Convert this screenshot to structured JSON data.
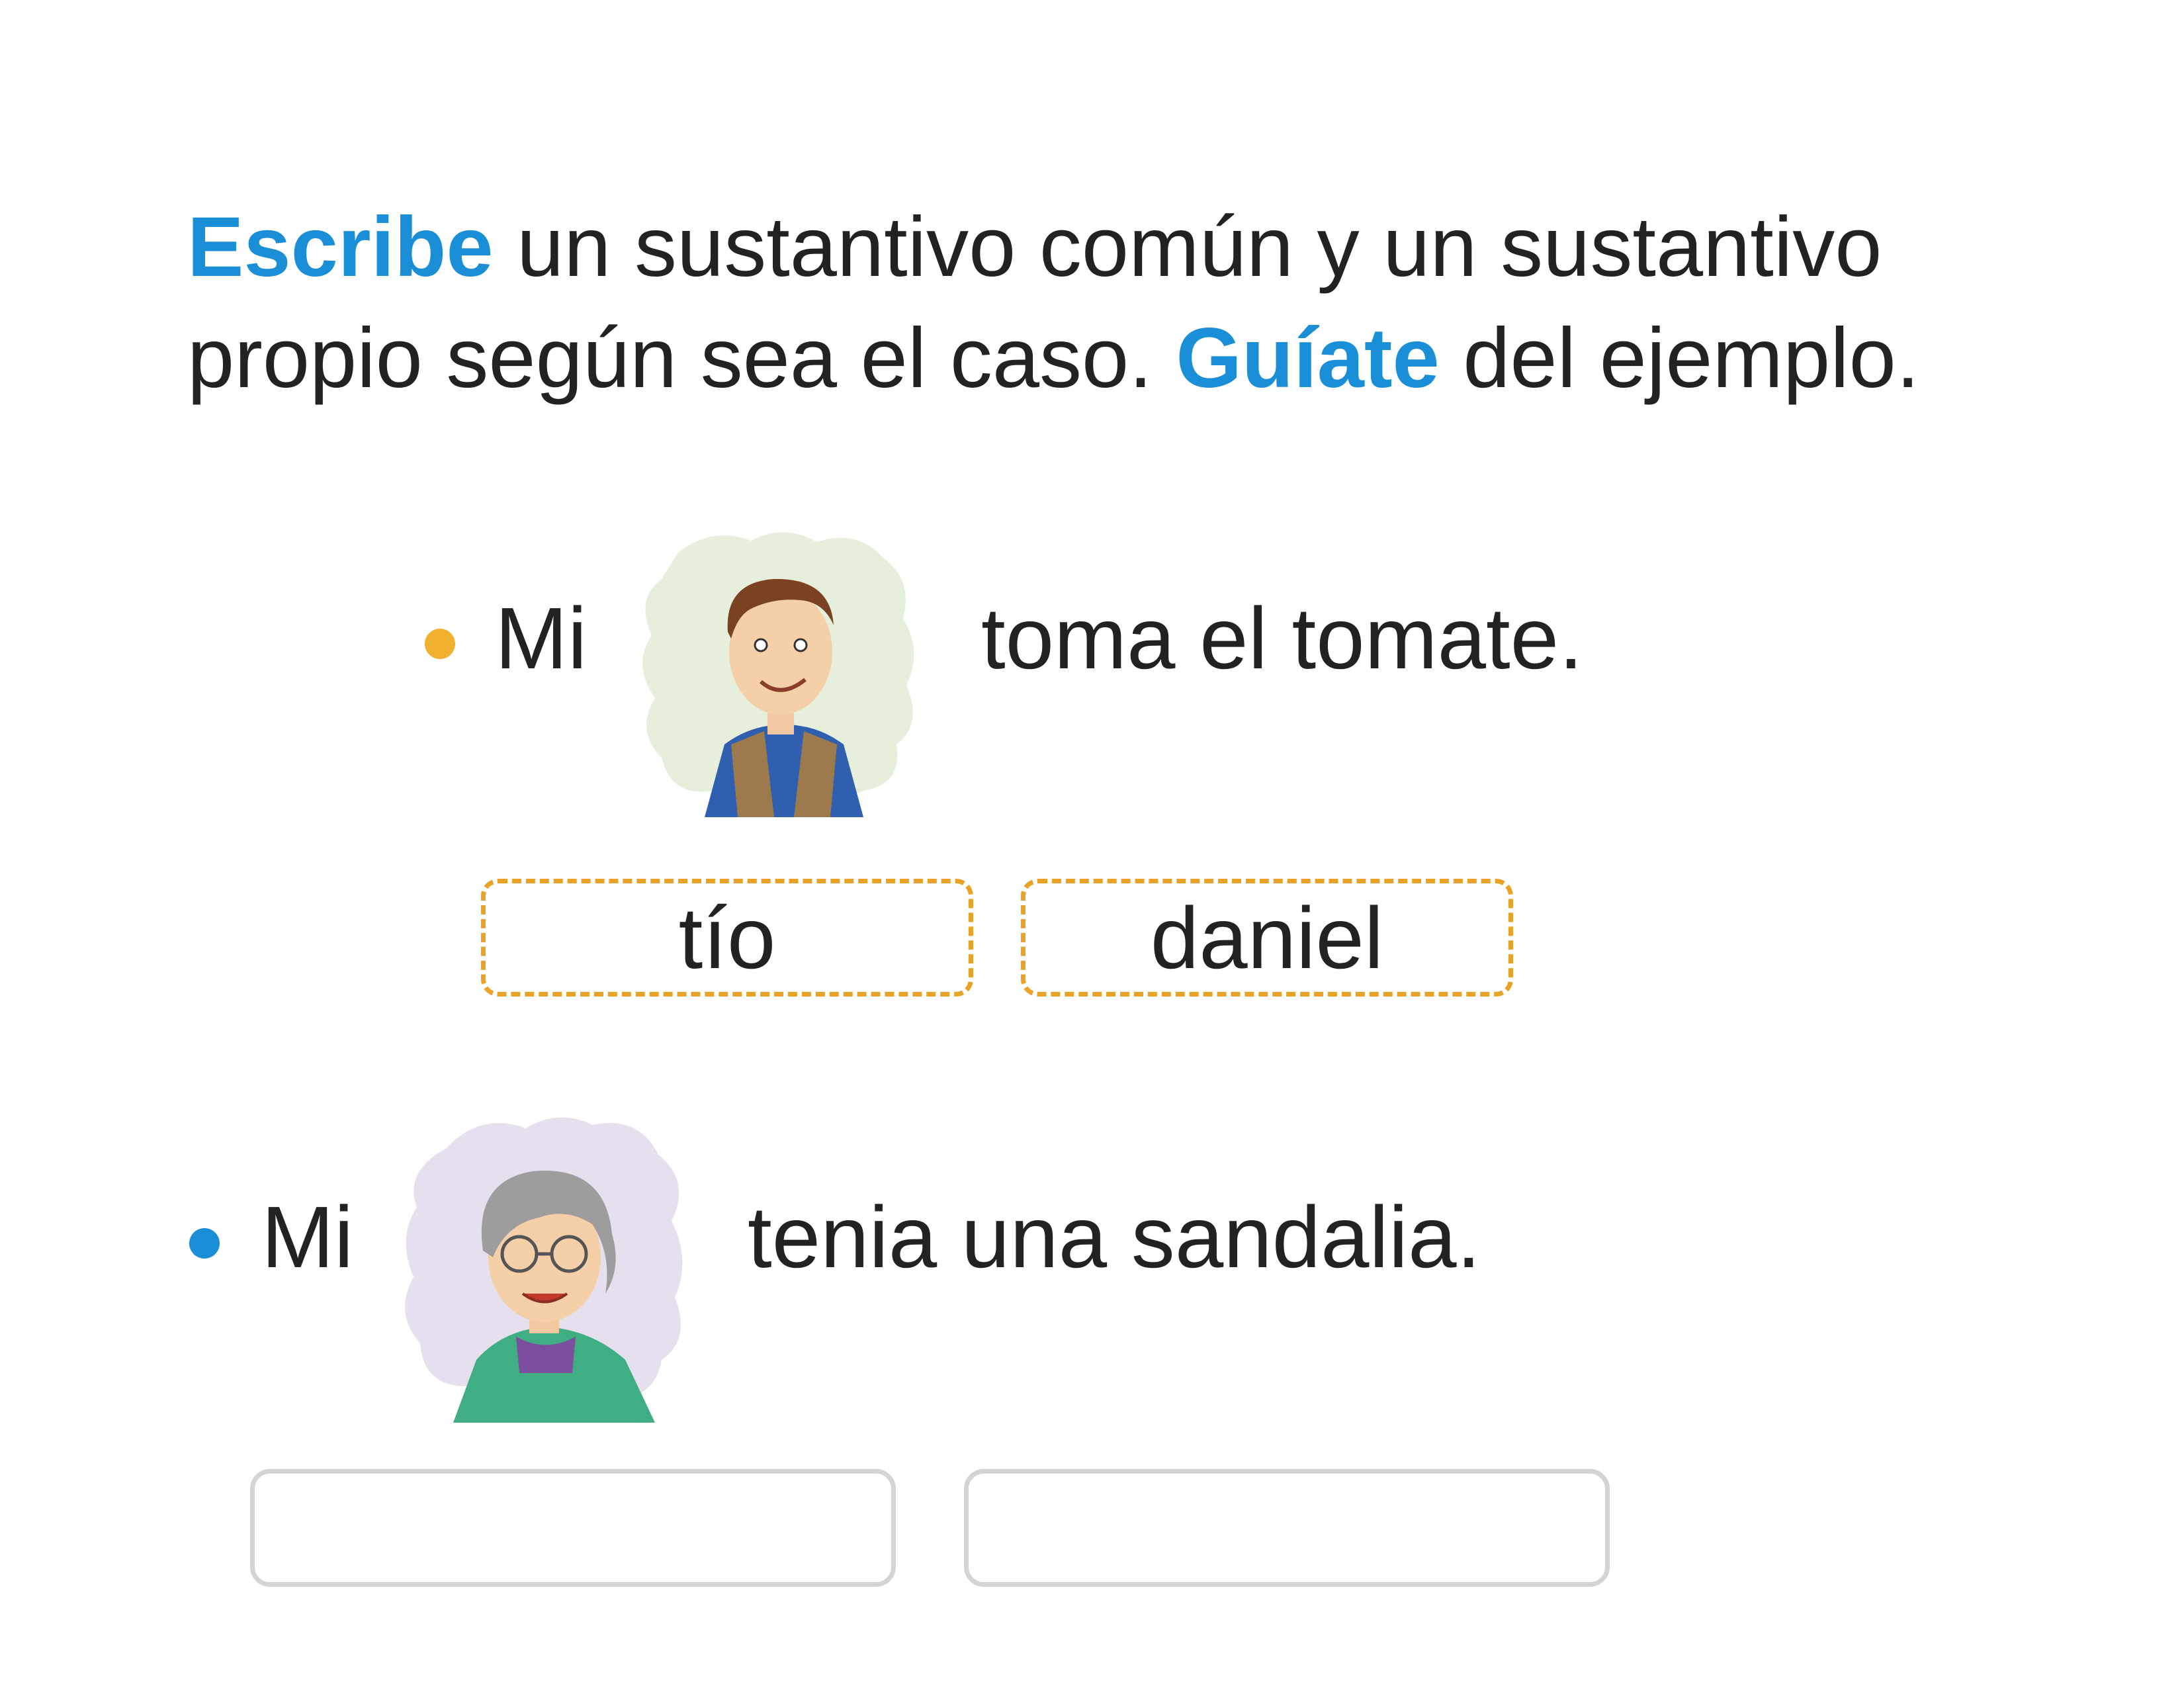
{
  "instructions": {
    "verb1": "Escribe",
    "text1": " un sustantivo común y un sustantivo propio según sea el caso. ",
    "verb2": "Guíate",
    "text2": " del ejemplo."
  },
  "colors": {
    "accent": "#1a8ed6",
    "example_bullet": "#f0b030",
    "dashed_border": "#e8a228"
  },
  "example": {
    "prefix": "Mi",
    "suffix": "toma el tomate.",
    "image_icon": "man-illustration-icon",
    "common_noun": "tío",
    "proper_noun": "daniel"
  },
  "exercise": {
    "prefix": "Mi",
    "suffix": "tenia una sandalia.",
    "image_icon": "grandmother-illustration-icon",
    "common_noun": "",
    "proper_noun": ""
  }
}
